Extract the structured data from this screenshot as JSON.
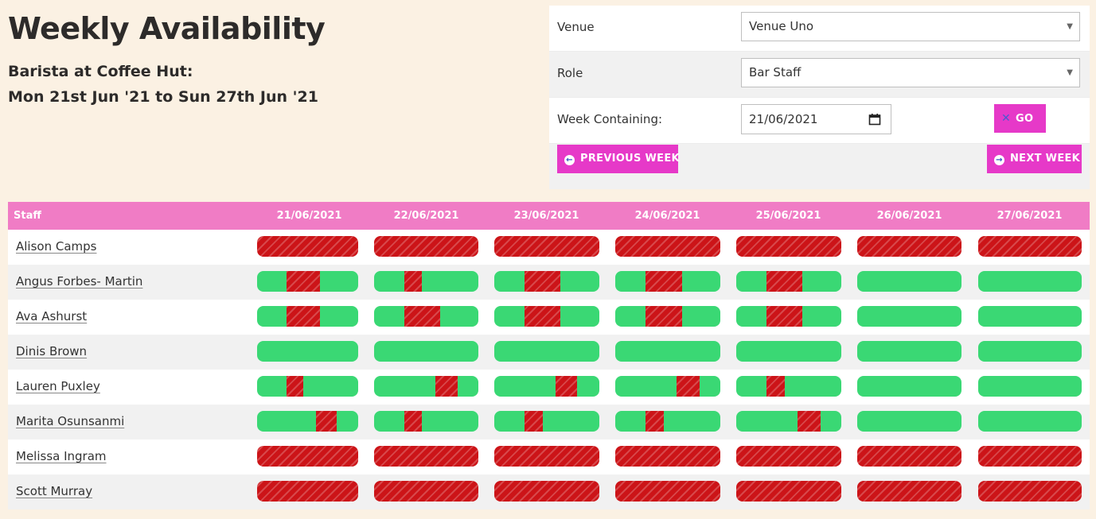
{
  "page": {
    "title": "Weekly Availability",
    "subtitle_line1": "Barista at Coffee Hut:",
    "subtitle_line2": "Mon 21st Jun '21 to Sun 27th Jun '21"
  },
  "filters": {
    "venue_label": "Venue",
    "venue_value": "Venue Uno",
    "role_label": "Role",
    "role_value": "Bar Staff",
    "week_label": "Week Containing:",
    "week_value": "21/06/2021",
    "go_label": "GO",
    "prev_label": "PREVIOUS WEEK",
    "next_label": "NEXT WEEK"
  },
  "icons": {
    "select_caret": "triangle-down-icon",
    "calendar": "calendar-icon",
    "go": "cross-icon",
    "prev": "arrow-left-circle-icon",
    "next": "arrow-right-circle-icon"
  },
  "colors": {
    "background": "#fbf1e3",
    "accent": "#e639c8",
    "header": "#f07cc5",
    "available": "#3ad874",
    "unavailable": "#cc1418"
  },
  "grid": {
    "staff_header": "Staff",
    "dates": [
      "21/06/2021",
      "22/06/2021",
      "23/06/2021",
      "24/06/2021",
      "25/06/2021",
      "26/06/2021",
      "27/06/2021"
    ],
    "rows": [
      {
        "name": "Alison Camps",
        "days": [
          {
            "busy": [
              [
                0,
                1
              ]
            ]
          },
          {
            "busy": [
              [
                0,
                1
              ]
            ]
          },
          {
            "busy": [
              [
                0,
                1
              ]
            ]
          },
          {
            "busy": [
              [
                0,
                1
              ]
            ]
          },
          {
            "busy": [
              [
                0,
                1
              ]
            ]
          },
          {
            "busy": [
              [
                0,
                1
              ]
            ]
          },
          {
            "busy": [
              [
                0,
                1
              ]
            ]
          }
        ]
      },
      {
        "name": "Angus Forbes- Martin",
        "days": [
          {
            "busy": [
              [
                0.29,
                0.62
              ]
            ]
          },
          {
            "busy": [
              [
                0.29,
                0.46
              ]
            ]
          },
          {
            "busy": [
              [
                0.29,
                0.63
              ]
            ]
          },
          {
            "busy": [
              [
                0.29,
                0.64
              ]
            ]
          },
          {
            "busy": [
              [
                0.29,
                0.63
              ]
            ]
          },
          {
            "busy": []
          },
          {
            "busy": []
          }
        ]
      },
      {
        "name": "Ava Ashurst",
        "days": [
          {
            "busy": [
              [
                0.29,
                0.62
              ]
            ]
          },
          {
            "busy": [
              [
                0.29,
                0.63
              ]
            ]
          },
          {
            "busy": [
              [
                0.29,
                0.63
              ]
            ]
          },
          {
            "busy": [
              [
                0.29,
                0.64
              ]
            ]
          },
          {
            "busy": [
              [
                0.29,
                0.63
              ]
            ]
          },
          {
            "busy": []
          },
          {
            "busy": []
          }
        ]
      },
      {
        "name": "Dinis Brown",
        "days": [
          {
            "busy": []
          },
          {
            "busy": []
          },
          {
            "busy": []
          },
          {
            "busy": []
          },
          {
            "busy": []
          },
          {
            "busy": []
          },
          {
            "busy": []
          }
        ]
      },
      {
        "name": "Lauren Puxley",
        "days": [
          {
            "busy": [
              [
                0.29,
                0.46
              ]
            ]
          },
          {
            "busy": [
              [
                0.59,
                0.8
              ]
            ]
          },
          {
            "busy": [
              [
                0.58,
                0.79
              ]
            ]
          },
          {
            "busy": [
              [
                0.58,
                0.8
              ]
            ]
          },
          {
            "busy": [
              [
                0.29,
                0.46
              ]
            ]
          },
          {
            "busy": []
          },
          {
            "busy": []
          }
        ]
      },
      {
        "name": "Marita Osunsanmi",
        "days": [
          {
            "busy": [
              [
                0.58,
                0.79
              ]
            ]
          },
          {
            "busy": [
              [
                0.29,
                0.46
              ]
            ]
          },
          {
            "busy": [
              [
                0.29,
                0.46
              ]
            ]
          },
          {
            "busy": [
              [
                0.29,
                0.46
              ]
            ]
          },
          {
            "busy": [
              [
                0.58,
                0.8
              ]
            ]
          },
          {
            "busy": []
          },
          {
            "busy": []
          }
        ]
      },
      {
        "name": "Melissa Ingram",
        "days": [
          {
            "busy": [
              [
                0,
                1
              ]
            ]
          },
          {
            "busy": [
              [
                0,
                1
              ]
            ]
          },
          {
            "busy": [
              [
                0,
                1
              ]
            ]
          },
          {
            "busy": [
              [
                0,
                1
              ]
            ]
          },
          {
            "busy": [
              [
                0,
                1
              ]
            ]
          },
          {
            "busy": [
              [
                0,
                1
              ]
            ]
          },
          {
            "busy": [
              [
                0,
                1
              ]
            ]
          }
        ]
      },
      {
        "name": "Scott Murray",
        "days": [
          {
            "busy": [
              [
                0,
                1
              ]
            ]
          },
          {
            "busy": [
              [
                0,
                1
              ]
            ]
          },
          {
            "busy": [
              [
                0,
                1
              ]
            ]
          },
          {
            "busy": [
              [
                0,
                1
              ]
            ]
          },
          {
            "busy": [
              [
                0,
                1
              ]
            ]
          },
          {
            "busy": [
              [
                0,
                1
              ]
            ]
          },
          {
            "busy": [
              [
                0,
                1
              ]
            ]
          }
        ]
      }
    ]
  }
}
